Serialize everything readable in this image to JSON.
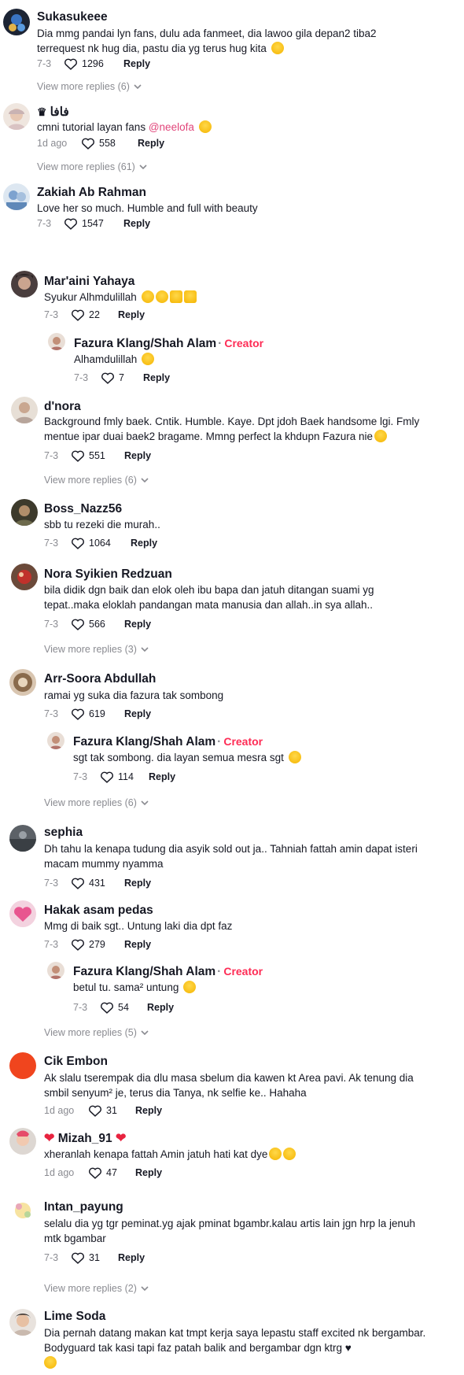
{
  "icons": {
    "like": "heart-outline-icon",
    "chevron": "chevron-down-icon",
    "emoji_grin": "grin-emoji-icon",
    "emoji_love": "heart-eyes-emoji-icon"
  },
  "colors": {
    "creator": "#fe2c55",
    "mention": "#e1457a",
    "muted": "#8a8b91"
  },
  "reply_label": "Reply",
  "creator_label": "Creator",
  "comments": [
    {
      "name": "Sukasukeee",
      "text": "Dia mmg pandai lyn fans, dulu ada fanmeet, dia lawoo gila depan2 tiba2 terrequest nk hug dia, pastu dia yg terus hug kita",
      "date": "7-3",
      "likes": "1296",
      "more": "View more replies (6)"
    },
    {
      "name": "فافا",
      "text": "cmni tutorial layan fans",
      "mention": "@neelofa",
      "date": "1d ago",
      "likes": "558",
      "more": "View more replies (61)"
    },
    {
      "name": "Zakiah Ab Rahman",
      "text": "Love her so much. Humble and full with beauty",
      "date": "7-3",
      "likes": "1547"
    },
    {
      "name": "Mar'aini Yahaya",
      "text": "Syukur Alhmdulillah",
      "date": "7-3",
      "likes": "22"
    },
    {
      "name": "Fazura Klang/Shah Alam",
      "text": "Alhamdulillah",
      "date": "7-3",
      "likes": "7"
    },
    {
      "name": "d'nora",
      "text": "Background fmly baek. Cntik. Humble. Kaye. Dpt jdoh Baek handsome lgi. Fmly mentue ipar duai baek2 bragame. Mmng perfect la khdupn Fazura nie",
      "date": "7-3",
      "likes": "551",
      "more": "View more replies (6)"
    },
    {
      "name": "Boss_Nazz56",
      "text": "sbb tu rezeki die murah..",
      "date": "7-3",
      "likes": "1064"
    },
    {
      "name": "Nora Syikien Redzuan",
      "text": "bila didik dgn baik dan elok oleh ibu bapa dan jatuh ditangan suami yg tepat..maka eloklah pandangan mata manusia dan allah..in sya allah..",
      "date": "7-3",
      "likes": "566",
      "more": "View more replies (3)"
    },
    {
      "name": "Arr-Soora Abdullah",
      "text": "ramai yg suka dia fazura tak sombong",
      "date": "7-3",
      "likes": "619"
    },
    {
      "name": "Fazura Klang/Shah Alam",
      "text": "sgt tak sombong. dia layan semua mesra sgt",
      "date": "7-3",
      "likes": "114",
      "more": "View more replies (6)"
    },
    {
      "name": "sephia",
      "text": "Dh tahu la kenapa tudung dia asyik sold out ja.. Tahniah fattah amin dapat isteri macam mummy nyamma",
      "date": "7-3",
      "likes": "431"
    },
    {
      "name": "Hakak asam pedas",
      "text": "Mmg di baik sgt.. Untung laki dia dpt faz",
      "date": "7-3",
      "likes": "279"
    },
    {
      "name": "Fazura Klang/Shah Alam",
      "text": "betul tu. sama² untung",
      "date": "7-3",
      "likes": "54",
      "more": "View more replies (5)"
    },
    {
      "name": "Cik Embon",
      "text": "Ak slalu tserempak dia dlu masa sbelum dia kawen kt Area pavi. Ak tenung dia smbil senyum² je, terus dia Tanya, nk selfie ke.. Hahaha",
      "date": "1d ago",
      "likes": "31"
    },
    {
      "name": "Mizah_91",
      "text": "xheranlah kenapa fattah Amin jatuh hati kat dye",
      "date": "1d ago",
      "likes": "47"
    },
    {
      "name": "Intan_payung",
      "text": "selalu dia yg tgr peminat.yg ajak pminat bgambr.kalau artis lain jgn hrp la jenuh mtk bgambar",
      "date": "7-3",
      "likes": "31",
      "more": "View more replies (2)"
    },
    {
      "name": "Lime Soda",
      "text": "Dia pernah datang makan kat tmpt kerja saya lepastu staff excited nk bergambar. Bodyguard tak kasi tapi faz patah balik and bergambar dgn ktrg ♥",
      "date": "",
      "likes": ""
    }
  ]
}
